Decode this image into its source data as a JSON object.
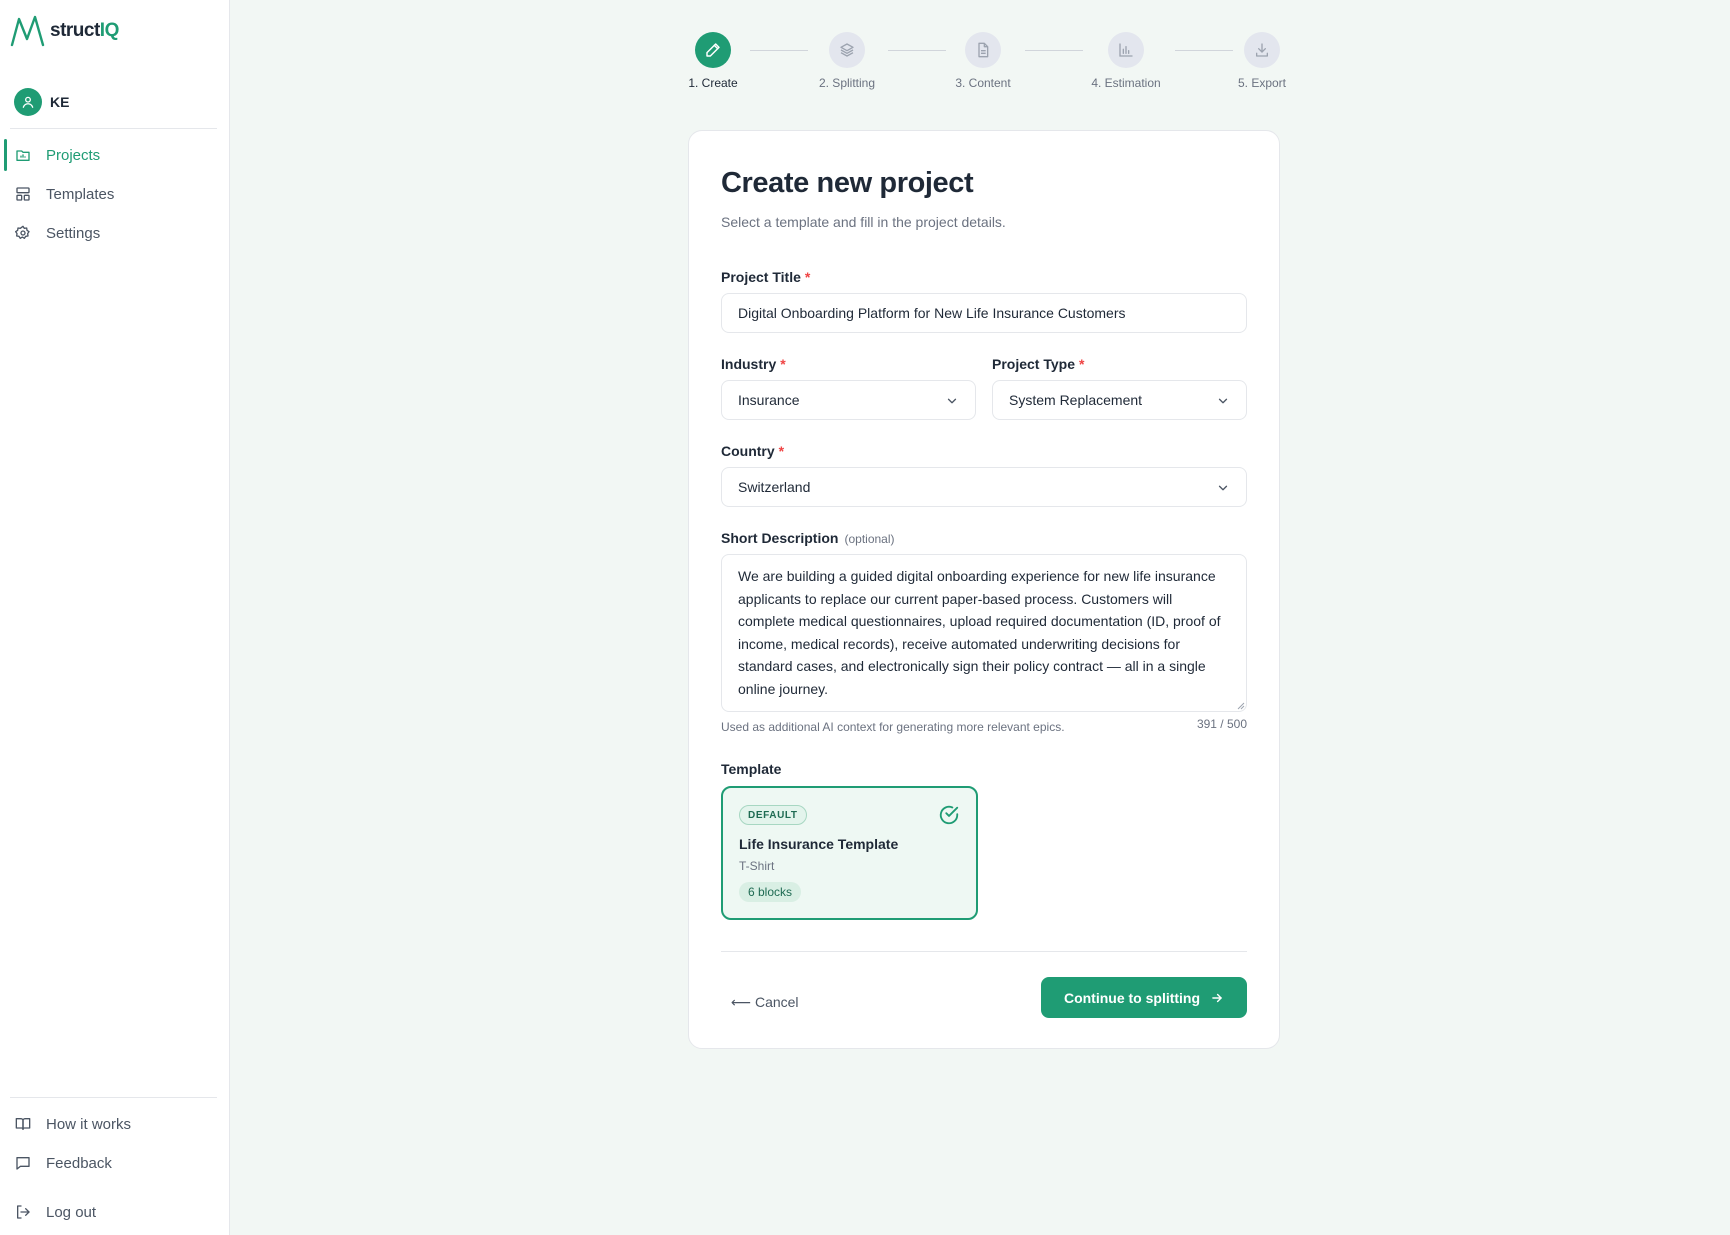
{
  "app": {
    "brand_prefix": "struct",
    "brand_suffix": "IQ",
    "brand_color": "#1f9c74"
  },
  "user": {
    "initials": "KE"
  },
  "sidebar": {
    "items": [
      {
        "label": "Projects",
        "icon": "folder-chart-icon",
        "active": true
      },
      {
        "label": "Templates",
        "icon": "layout-icon",
        "active": false
      },
      {
        "label": "Settings",
        "icon": "gear-icon",
        "active": false
      }
    ],
    "bottom_items": [
      {
        "label": "How it works",
        "icon": "book-icon"
      },
      {
        "label": "Feedback",
        "icon": "message-square-icon"
      },
      {
        "label": "Log out",
        "icon": "log-out-icon"
      }
    ]
  },
  "stepper": {
    "steps": [
      {
        "label": "1. Create",
        "icon": "pencil-icon",
        "active": true
      },
      {
        "label": "2. Splitting",
        "icon": "layers-icon",
        "active": false
      },
      {
        "label": "3. Content",
        "icon": "document-icon",
        "active": false
      },
      {
        "label": "4. Estimation",
        "icon": "bar-chart-icon",
        "active": false
      },
      {
        "label": "5. Export",
        "icon": "download-icon",
        "active": false
      }
    ]
  },
  "form": {
    "title": "Create new project",
    "subtitle": "Select a template and fill in the project details.",
    "project_title": {
      "label": "Project Title",
      "required_mark": "*",
      "value": "Digital Onboarding Platform for New Life Insurance Customers"
    },
    "industry": {
      "label": "Industry",
      "required_mark": "*",
      "value": "Insurance"
    },
    "project_type": {
      "label": "Project Type",
      "required_mark": "*",
      "value": "System Replacement"
    },
    "country": {
      "label": "Country",
      "required_mark": "*",
      "value": "Switzerland"
    },
    "description": {
      "label": "Short Description",
      "optional": "(optional)",
      "value": "We are building a guided digital onboarding experience for new life insurance applicants to replace our current paper-based process. Customers will complete medical questionnaires, upload required documentation (ID, proof of income, medical records), receive automated underwriting decisions for standard cases, and electronically sign their policy contract — all in a single online journey.",
      "hint": "Used as additional AI context for generating more relevant epics.",
      "counter": "391 / 500"
    },
    "template": {
      "label": "Template",
      "badge": "DEFAULT",
      "name": "Life Insurance Template",
      "size": "T-Shirt",
      "blocks": "6 blocks",
      "selected": true
    },
    "cancel_label": "⟵ Cancel",
    "continue_label": "Continue to splitting"
  }
}
